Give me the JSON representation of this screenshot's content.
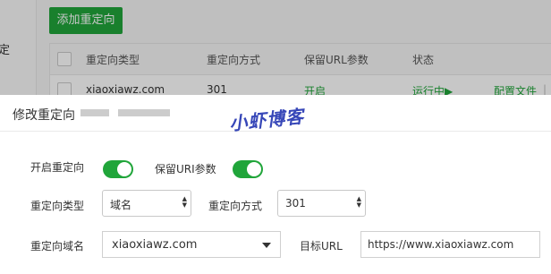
{
  "background": {
    "sidebar_char": "定",
    "add_button": "添加重定向",
    "table": {
      "headers": [
        "重定向类型",
        "重定向方式",
        "保留URL参数",
        "状态"
      ],
      "row": {
        "type": "xiaoxiawz.com",
        "method": "301",
        "keep_params": "开启",
        "status": "运行中▶",
        "action": "配置文件",
        "separator": "|"
      }
    }
  },
  "modal": {
    "title": "修改重定向",
    "watermark": "小虾博客",
    "enable_label": "开启重定向",
    "enable_on": true,
    "keep_uri_label": "保留URI参数",
    "keep_uri_on": true,
    "type_label": "重定向类型",
    "type_value": "域名",
    "method_label": "重定向方式",
    "method_value": "301",
    "domain_label": "重定向域名",
    "domain_value": "xiaoxiawz.com",
    "target_label": "目标URL",
    "target_value": "https://www.xiaoxiawz.com"
  },
  "colors": {
    "accent": "#20a53a",
    "watermark": "#3747b8"
  }
}
